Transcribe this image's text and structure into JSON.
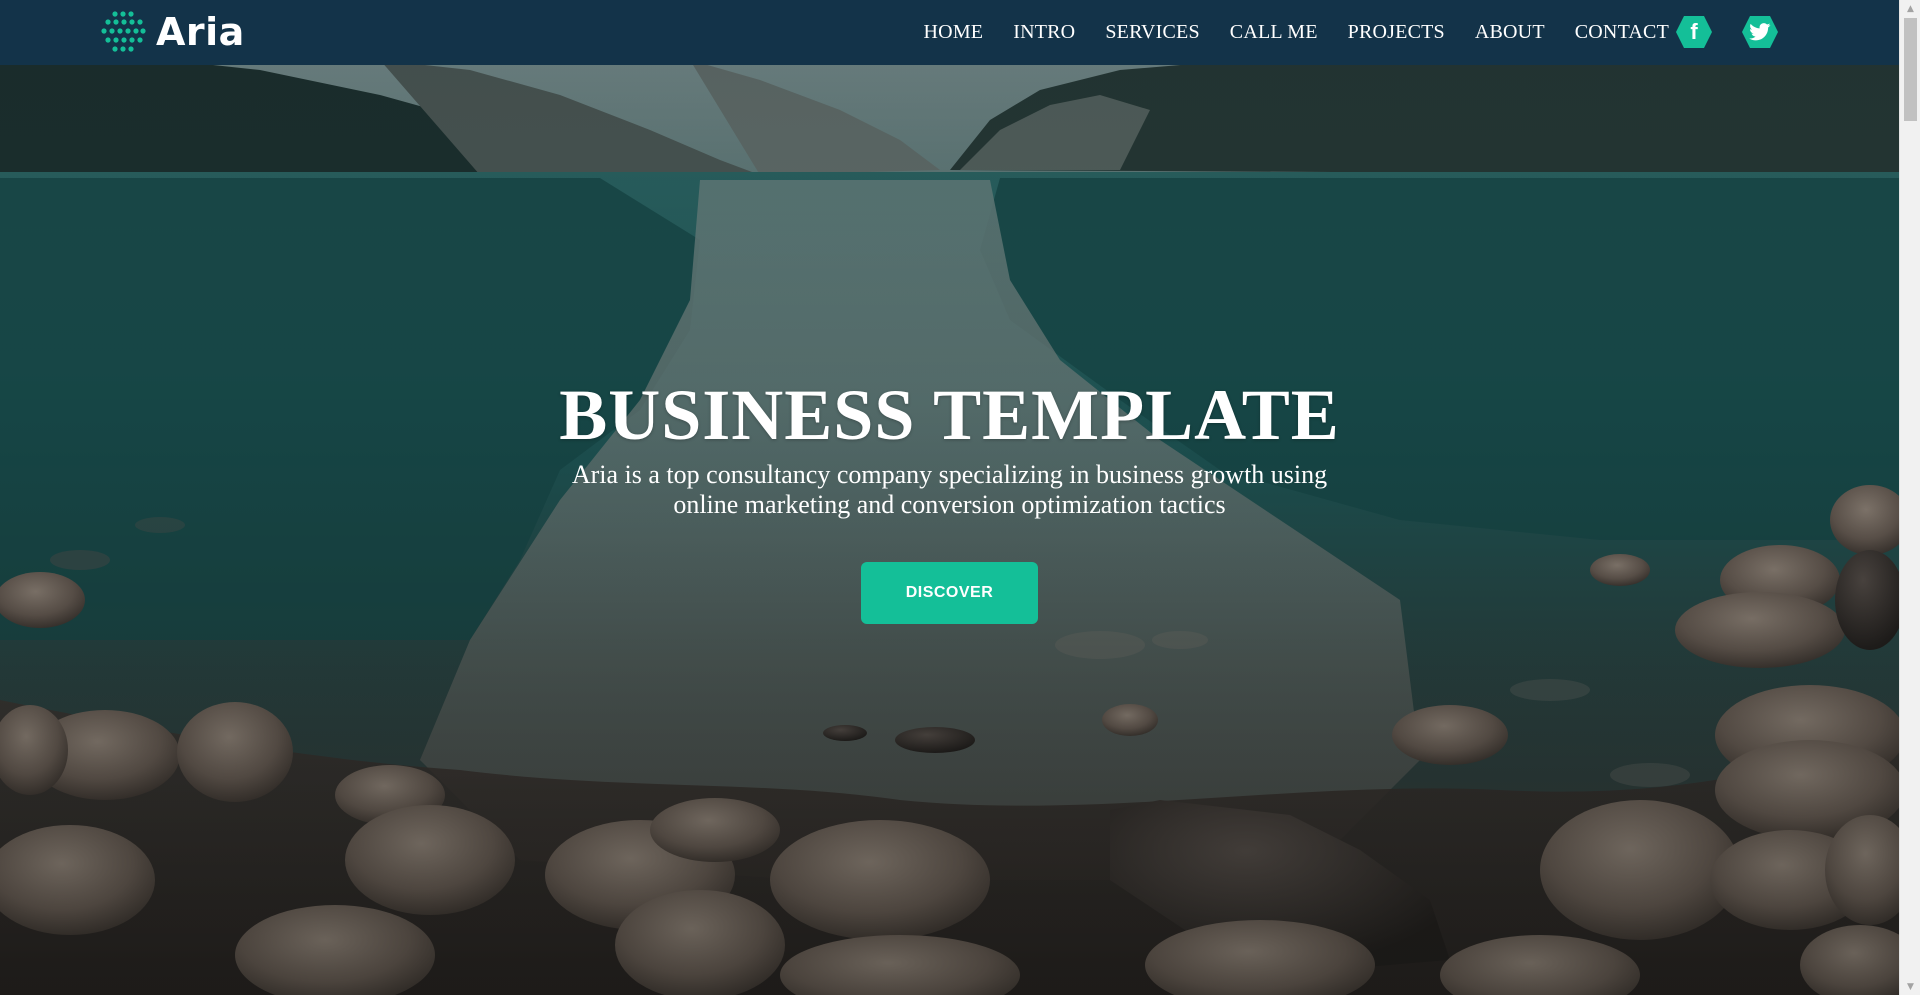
{
  "brand": {
    "name": "Aria",
    "icon": "dotted-globe-icon",
    "accent": "#14bf98"
  },
  "nav": {
    "items": [
      {
        "label": "HOME"
      },
      {
        "label": "INTRO"
      },
      {
        "label": "SERVICES"
      },
      {
        "label": "CALL ME"
      },
      {
        "label": "PROJECTS"
      },
      {
        "label": "ABOUT"
      },
      {
        "label": "CONTACT"
      }
    ],
    "background": "#133349"
  },
  "socials": [
    {
      "icon": "facebook-icon",
      "glyph": "f"
    },
    {
      "icon": "twitter-icon"
    }
  ],
  "hero": {
    "title": "BUSINESS TEMPLATE",
    "subtitle": "Aria is a top consultancy company specializing in business growth using online marketing and conversion optimization tactics",
    "button_label": "DISCOVER",
    "button_color": "#14bf98"
  }
}
